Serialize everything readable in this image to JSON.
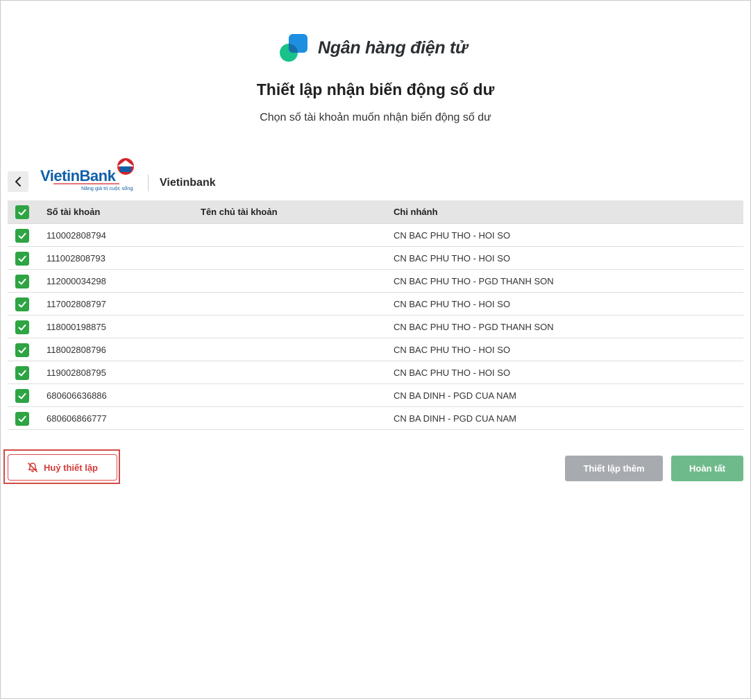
{
  "brand": {
    "name": "Ngân hàng điện tử",
    "colors": {
      "teal": "#19c28a",
      "blue": "#1e8ee0",
      "dark": "#2b2f33"
    }
  },
  "page": {
    "title": "Thiết lập nhận biến động số dư",
    "subtitle": "Chọn số tài khoản muốn nhận biến động số dư"
  },
  "bank": {
    "logo_text": "VietinBank",
    "logo_tagline": "Nâng giá trị cuộc sống",
    "name": "Vietinbank",
    "back_icon": "chevron-left-icon"
  },
  "table": {
    "headers": {
      "account_number": "Số tài khoản",
      "account_owner": "Tên chủ tài khoản",
      "branch": "Chi nhánh"
    },
    "header_checked": true,
    "rows": [
      {
        "checked": true,
        "account_number": "110002808794",
        "owner": "",
        "branch": "CN BAC PHU THO - HOI SO"
      },
      {
        "checked": true,
        "account_number": "111002808793",
        "owner": "",
        "branch": "CN BAC PHU THO - HOI SO"
      },
      {
        "checked": true,
        "account_number": "112000034298",
        "owner": "",
        "branch": "CN BAC PHU THO - PGD THANH SON"
      },
      {
        "checked": true,
        "account_number": "117002808797",
        "owner": "",
        "branch": "CN BAC PHU THO - HOI SO"
      },
      {
        "checked": true,
        "account_number": "118000198875",
        "owner": "",
        "branch": "CN BAC PHU THO - PGD THANH SON"
      },
      {
        "checked": true,
        "account_number": "118002808796",
        "owner": "",
        "branch": "CN BAC PHU THO - HOI SO"
      },
      {
        "checked": true,
        "account_number": "119002808795",
        "owner": "",
        "branch": "CN BAC PHU THO - HOI SO"
      },
      {
        "checked": true,
        "account_number": "680606636886",
        "owner": "",
        "branch": "CN BA DINH - PGD CUA NAM"
      },
      {
        "checked": true,
        "account_number": "680606866777",
        "owner": "",
        "branch": "CN BA DINH - PGD CUA NAM"
      }
    ]
  },
  "actions": {
    "cancel_label": "Huỷ thiết lập",
    "cancel_icon": "bell-off-icon",
    "more_label": "Thiết lập thêm",
    "done_label": "Hoàn tất"
  },
  "colors": {
    "checkbox": "#2ea443",
    "cancel": "#d43a3a",
    "more_button": "#a7abaf",
    "done_button": "#6fba8b"
  }
}
